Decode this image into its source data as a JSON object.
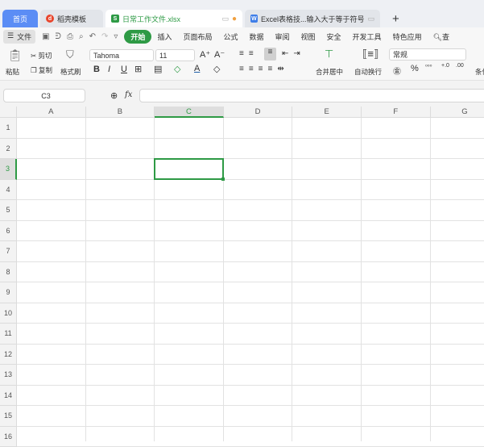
{
  "tabs": [
    {
      "label": "首页",
      "active": false
    },
    {
      "label": "稻壳模板",
      "icon": "daoke-icon"
    },
    {
      "label": "日常工作文件.xlsx",
      "icon": "spreadsheet-icon",
      "active": true
    },
    {
      "label": "Excel表格技...输入大于等于符号",
      "icon": "word-icon"
    }
  ],
  "new_tab": "+",
  "menu": {
    "file": "文件",
    "items": [
      "开始",
      "插入",
      "页面布局",
      "公式",
      "数据",
      "审阅",
      "视图",
      "安全",
      "开发工具",
      "特色应用"
    ],
    "active": "开始",
    "search": "查"
  },
  "toolbar": {
    "paste": "粘贴",
    "cut": "剪切",
    "copy": "复制",
    "format_painter": "格式刷",
    "font": "Tahoma",
    "size": "11",
    "merge": "合并居中",
    "wrap": "自动换行",
    "number_format": "常规",
    "percent": "%",
    "cond": "条件"
  },
  "formula": {
    "cell_ref": "C3",
    "fx": "fx",
    "value": ""
  },
  "columns": [
    "A",
    "B",
    "C",
    "D",
    "E",
    "F",
    "G"
  ],
  "rows": [
    "1",
    "2",
    "3",
    "4",
    "5",
    "6",
    "7",
    "8",
    "9",
    "10",
    "11",
    "12",
    "13",
    "14",
    "15",
    "16"
  ],
  "selected": {
    "col": "C",
    "row": "3"
  },
  "colors": {
    "accent": "#2e9a45",
    "home_tab": "#5b8df5"
  }
}
